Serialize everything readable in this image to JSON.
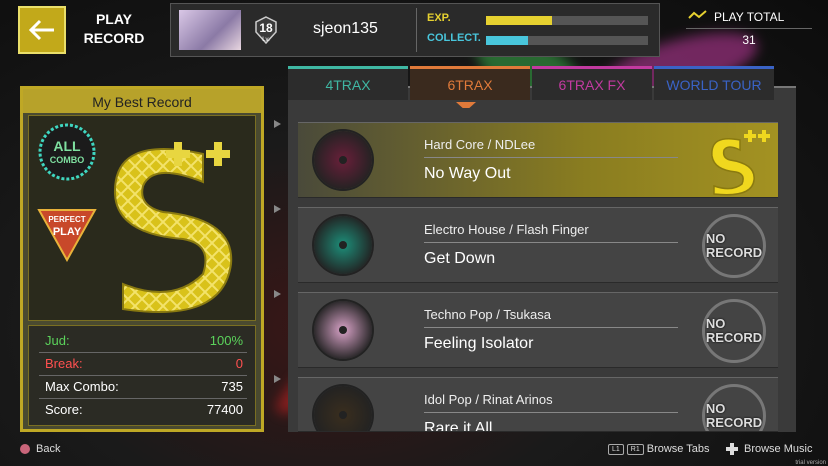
{
  "header": {
    "back_label": "PLAY\nRECORD",
    "username": "sjeon135",
    "level": "18",
    "level_caption": "Lv.",
    "exp_label": "EXP.",
    "exp_fill": 0.41,
    "collect_label": "COLLECT.",
    "collect_fill": 0.26,
    "play_total_label": "PLAY TOTAL",
    "play_total_value": "31"
  },
  "tabs": [
    {
      "label": "4TRAX",
      "color": "#3fb7a3"
    },
    {
      "label": "6TRAX",
      "color": "#e07a3a"
    },
    {
      "label": "6TRAX FX",
      "color": "#c23aa0"
    },
    {
      "label": "WORLD TOUR",
      "color": "#3a63c6"
    }
  ],
  "best_record": {
    "title": "My Best Record",
    "grade": "S++",
    "all_combo_top": "ALL",
    "all_combo_bottom": "COMBO",
    "perfect_top": "PERFECT",
    "perfect_bottom": "PLAY",
    "stats": [
      {
        "key": "Jud:",
        "value": "100%",
        "color": "#5bd35b"
      },
      {
        "key": "Break:",
        "value": "0",
        "color": "#ff5050"
      },
      {
        "key": "Max Combo:",
        "value": "735",
        "color": "#ffffff"
      },
      {
        "key": "Score:",
        "value": "77400",
        "color": "#ffffff"
      }
    ]
  },
  "songs": [
    {
      "genre": "Hard Core / NDLee",
      "title": "No Way Out",
      "record": "S++",
      "selected": true,
      "disc": "#6a1f3a"
    },
    {
      "genre": "Electro House / Flash Finger",
      "title": "Get Down",
      "record": "NO RECORD",
      "selected": false,
      "disc": "#1d8f7a"
    },
    {
      "genre": "Techno Pop / Tsukasa",
      "title": "Feeling Isolator",
      "record": "NO RECORD",
      "selected": false,
      "disc": "#d9a3c8"
    },
    {
      "genre": "Idol Pop / Rinat Arinos",
      "title": "Rare it All",
      "record": "NO RECORD",
      "selected": false,
      "disc": "#3a2e1e"
    }
  ],
  "footer": {
    "back": "Back",
    "l1": "L1",
    "r1": "R1",
    "browse_tabs": "Browse Tabs",
    "browse_music": "Browse Music",
    "trial": "trial version"
  },
  "colors": {
    "gold": "#bfa825",
    "accent_exp": "#e6d130",
    "accent_collect": "#49c6dc"
  }
}
